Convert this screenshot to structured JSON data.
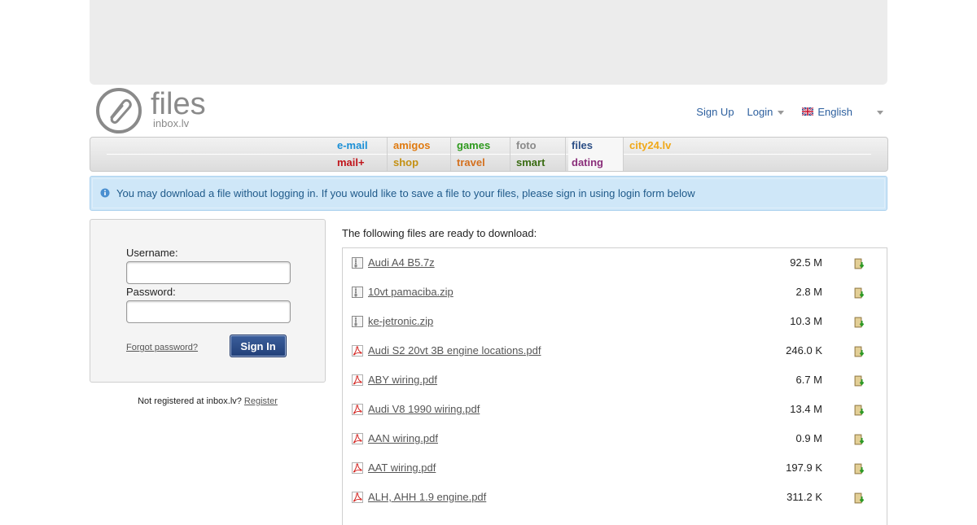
{
  "header": {
    "logo_text": "files",
    "logo_subtext": "inbox.lv",
    "signup_label": "Sign Up",
    "login_label": "Login",
    "language_label": "English"
  },
  "nav": {
    "columns": [
      {
        "top": {
          "label": "e-mail",
          "color": "#1a8fd6"
        },
        "bottom": {
          "label": "mail+",
          "color": "#c0141a"
        }
      },
      {
        "top": {
          "label": "amigos",
          "color": "#e07a10"
        },
        "bottom": {
          "label": "shop",
          "color": "#c49012"
        }
      },
      {
        "top": {
          "label": "games",
          "color": "#2f9a1e"
        },
        "bottom": {
          "label": "travel",
          "color": "#d4701e"
        }
      },
      {
        "top": {
          "label": "foto",
          "color": "#8a8a8a"
        },
        "bottom": {
          "label": "smart",
          "color": "#3a6b12"
        }
      },
      {
        "top": {
          "label": "files",
          "color": "#2c4f86"
        },
        "bottom": {
          "label": "dating",
          "color": "#8a2e7a"
        }
      },
      {
        "top": {
          "label": "city24.lv",
          "color": "#f0a818"
        },
        "bottom": {
          "label": "",
          "color": "#000000"
        }
      }
    ]
  },
  "info": {
    "message": "You may download a file without logging in. If you would like to save a file to your files, please sign in using login form below"
  },
  "login_form": {
    "username_label": "Username:",
    "password_label": "Password:",
    "username_value": "",
    "password_value": "",
    "forgot_label": "Forgot password?",
    "signin_label": "Sign In",
    "not_registered_text": "Not registered at inbox.lv?",
    "register_label": "Register"
  },
  "files": {
    "heading": "The following files are ready to download:",
    "items": [
      {
        "name": "Audi A4 B5.7z",
        "size": "92.5 M",
        "type": "archive"
      },
      {
        "name": "10vt pamaciba.zip",
        "size": "2.8 M",
        "type": "archive"
      },
      {
        "name": "ke-jetronic.zip",
        "size": "10.3 M",
        "type": "archive"
      },
      {
        "name": "Audi S2 20vt 3B engine locations.pdf",
        "size": "246.0 K",
        "type": "pdf"
      },
      {
        "name": "ABY wiring.pdf",
        "size": "6.7 M",
        "type": "pdf"
      },
      {
        "name": "Audi V8 1990 wiring.pdf",
        "size": "13.4 M",
        "type": "pdf"
      },
      {
        "name": "AAN wiring.pdf",
        "size": "0.9 M",
        "type": "pdf"
      },
      {
        "name": "AAT wiring.pdf",
        "size": "197.9 K",
        "type": "pdf"
      },
      {
        "name": "ALH, AHH 1.9 engine.pdf",
        "size": "311.2 K",
        "type": "pdf"
      }
    ]
  }
}
